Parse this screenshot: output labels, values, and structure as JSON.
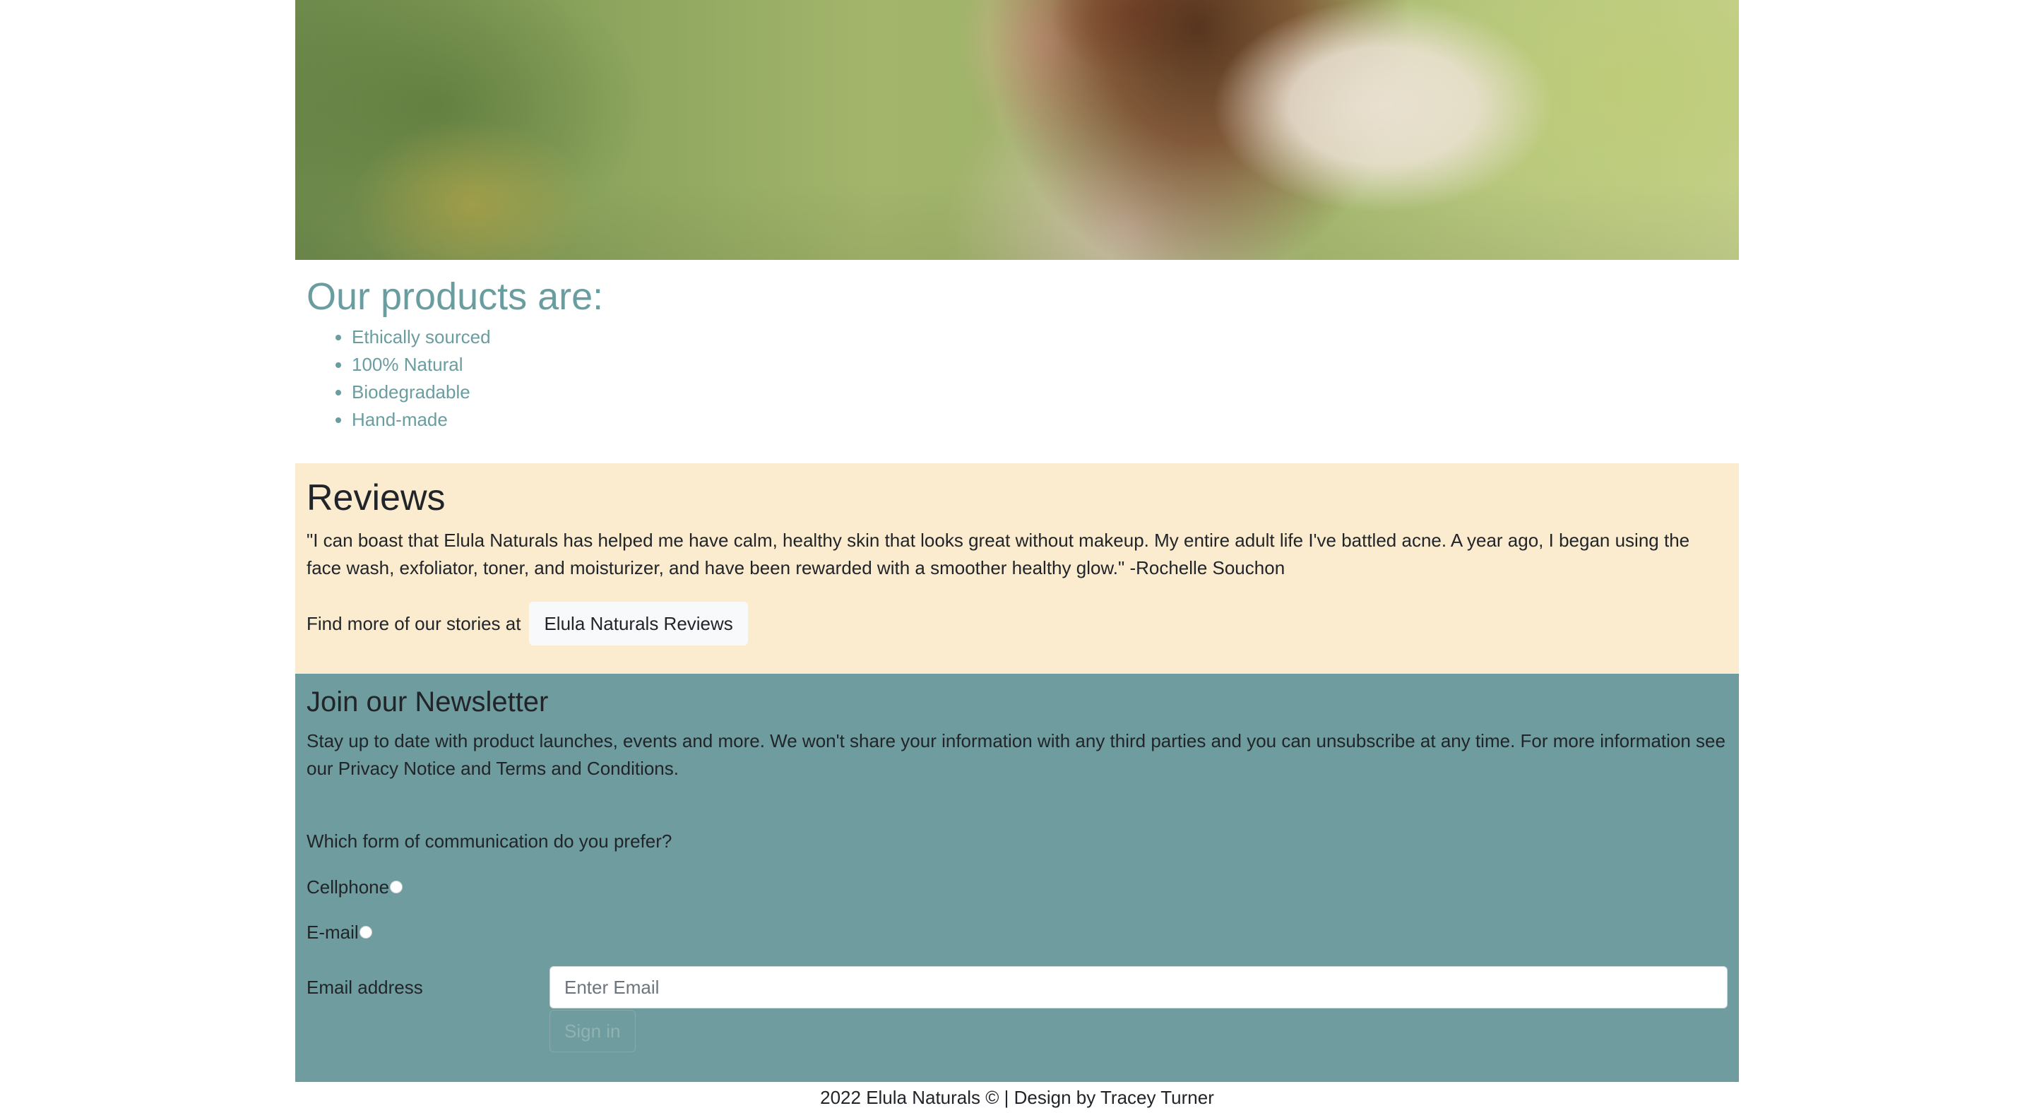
{
  "products": {
    "heading": "Our products are:",
    "items": [
      "Ethically sourced",
      "100% Natural",
      "Biodegradable",
      "Hand-made"
    ]
  },
  "reviews": {
    "heading": "Reviews",
    "quote": "\"I can boast that Elula Naturals has helped me have calm, healthy skin that looks great without makeup. My entire adult life I've battled acne. A year ago, I began using the face wash, exfoliator, toner, and moisturizer, and have been rewarded with a smoother healthy glow.\" -Rochelle Souchon",
    "more_text": "Find more of our stories at",
    "more_button": "Elula Naturals Reviews"
  },
  "newsletter": {
    "heading": "Join our Newsletter",
    "description": "Stay up to date with product launches, events and more. We won't share your information with any third parties and you can unsubscribe at any time. For more information see our Privacy Notice and Terms and Conditions.",
    "question": "Which form of communication do you prefer?",
    "options": [
      "Cellphone",
      "E-mail"
    ],
    "email_label": "Email address",
    "email_placeholder": "Enter Email",
    "email_value": "",
    "submit_label": "Sign in"
  },
  "footer": {
    "text": "2022 Elula Naturals © | Design by Tracey Turner"
  },
  "colors": {
    "accent": "#6a9da0",
    "reviews_bg": "#fbebcf",
    "newsletter_bg": "#6f9c9e"
  }
}
